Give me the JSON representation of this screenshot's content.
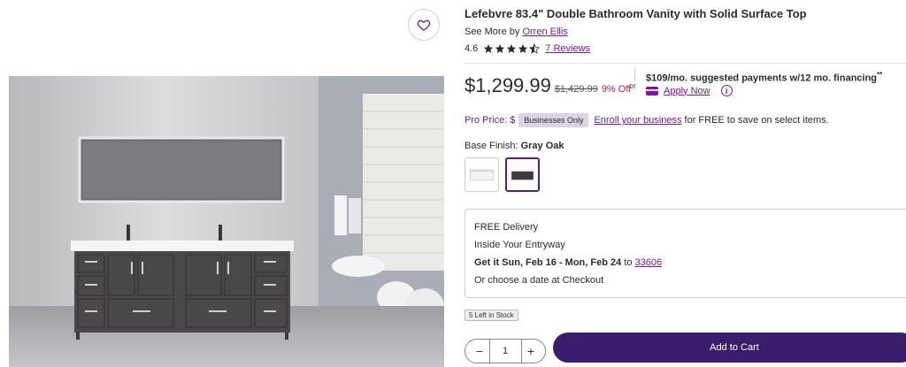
{
  "product": {
    "title": "Lefebvre 83.4\" Double Bathroom Vanity with Solid Surface Top",
    "see_more_prefix": "See More by",
    "brand": "Orren Ellis",
    "rating": "4.6",
    "rating_stars": 4.6,
    "reviews_link": "7 Reviews"
  },
  "price": {
    "current": "$1,299.99",
    "was": "$1,429.99",
    "discount": "9% Off",
    "or": "or",
    "financing": "$109/mo. suggested payments w/12 mo. financing",
    "financing_mark": "**",
    "apply_now": "Apply Now"
  },
  "pro": {
    "label": "Pro Price:",
    "dollar": "$",
    "badge": "Businesses Only",
    "enroll_link": "Enroll your business",
    "suffix": "for FREE to save on select items."
  },
  "finish": {
    "label": "Base Finish:",
    "selected": "Gray Oak"
  },
  "delivery": {
    "line1": "FREE Delivery",
    "line2": "Inside Your Entryway",
    "line3_prefix": "Get it Sun, Feb 16 - Mon, Feb 24",
    "line3_to": "to",
    "zip": "33606",
    "line4": "Or choose a date at Checkout"
  },
  "stock": "5 Left in Stock",
  "quantity": {
    "minus": "−",
    "value": "1",
    "plus": "+"
  },
  "cart": {
    "add_label": "Add to Cart"
  },
  "colors": {
    "accent": "#7b189f",
    "cart_button": "#3b1d6d",
    "discount": "#c7154f"
  }
}
